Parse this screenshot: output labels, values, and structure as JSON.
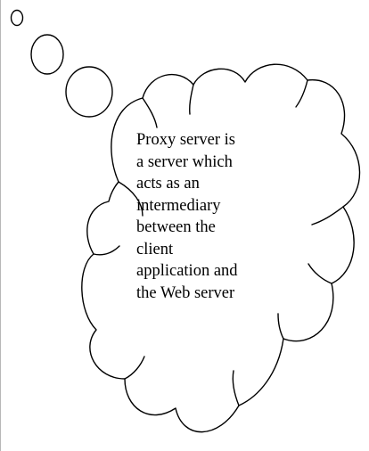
{
  "thought_bubble": {
    "lines": [
      "Proxy server is",
      "a server which",
      "acts as an",
      "intermediary",
      "between the",
      "client",
      "application and",
      "the Web server"
    ]
  }
}
